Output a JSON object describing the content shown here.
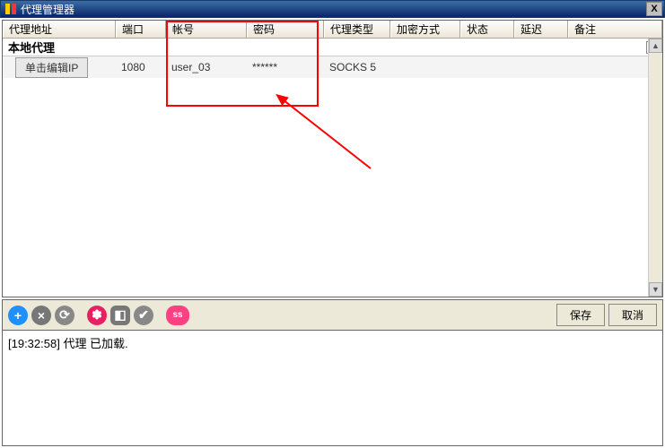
{
  "window": {
    "title": "代理管理器",
    "close": "X"
  },
  "columns": {
    "addr": "代理地址",
    "port": "端口",
    "user": "帐号",
    "pass": "密码",
    "type": "代理类型",
    "enc": "加密方式",
    "stat": "状态",
    "lat": "延迟",
    "note": "备注"
  },
  "section": {
    "label": "本地代理",
    "collapse": "-"
  },
  "row": {
    "ipbtn": "单击编辑IP",
    "port": "1080",
    "user": "user_03",
    "pass": "******",
    "type": "SOCKS 5",
    "enc": "",
    "stat": "",
    "lat": "",
    "note": ""
  },
  "toolbar": {
    "add": "+",
    "del": "×",
    "ref": "⟳",
    "gear": "✽",
    "box": "◧",
    "ok": "✔",
    "ss": "ss",
    "save": "保存",
    "cancel": "取消"
  },
  "log": {
    "line1": "[19:32:58]  代理  已加载."
  },
  "scroll": {
    "up": "▲",
    "down": "▼"
  }
}
